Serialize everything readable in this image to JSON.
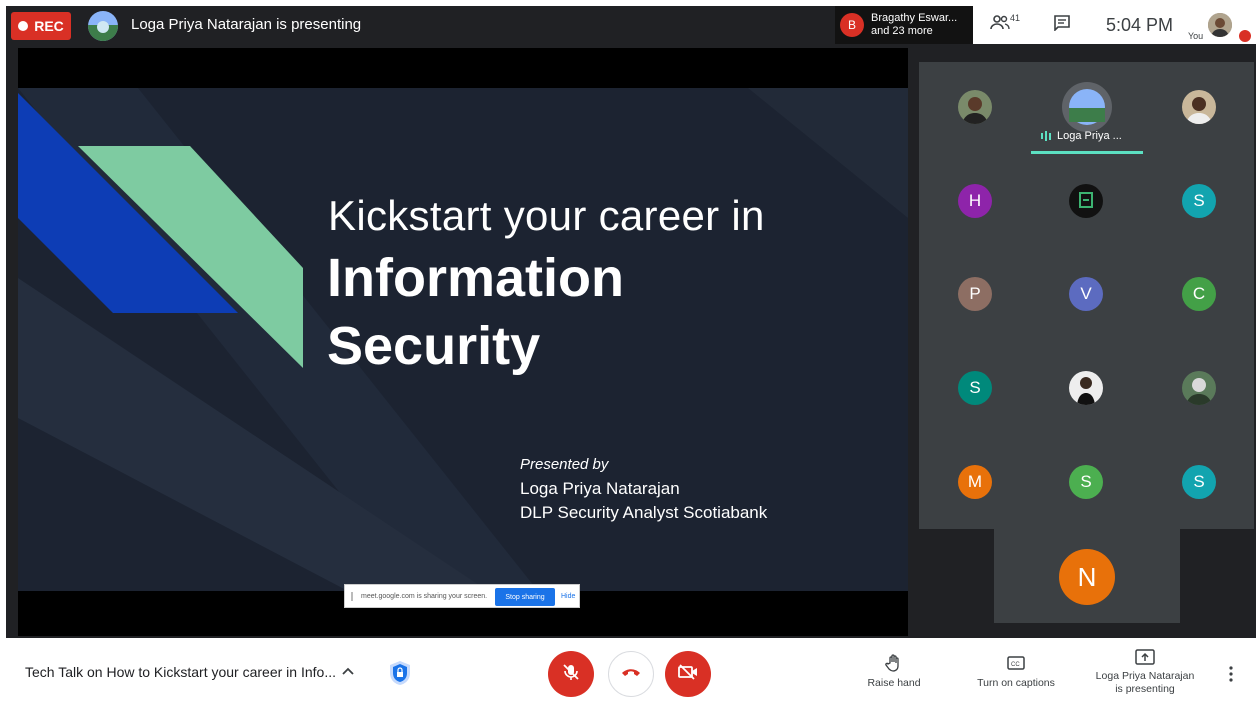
{
  "top_bar": {
    "rec_label": "REC",
    "presenting_title": "Loga Priya Natarajan is presenting",
    "raised_badge_letter": "B",
    "raised_line1": "Bragathy Eswar...",
    "raised_line2": "and 23 more",
    "people_count": "41",
    "time": "5:04 PM",
    "you_label": "You"
  },
  "slide": {
    "title_line1": "Kickstart your career in",
    "title_line2": "Information",
    "title_line3": "Security",
    "presented_by": "Presented by",
    "presenter": "Loga Priya Natarajan",
    "role": "DLP Security Analyst Scotiabank"
  },
  "share_notice": {
    "text": "meet.google.com is sharing your screen.",
    "stop_label": "Stop sharing",
    "hide_label": "Hide"
  },
  "participants": {
    "speaker_name": "Loga Priya ...",
    "tiles": [
      {
        "letter": "H",
        "color": "#8e24aa"
      },
      {
        "letter": "S",
        "color": "#12a4af"
      },
      {
        "letter": "P",
        "color": "#8d6e63"
      },
      {
        "letter": "V",
        "color": "#5c6bc0"
      },
      {
        "letter": "C",
        "color": "#43a047"
      },
      {
        "letter": "S",
        "color": "#00897b"
      },
      {
        "letter": "M",
        "color": "#e8710a"
      },
      {
        "letter": "S",
        "color": "#4caf50"
      },
      {
        "letter": "S",
        "color": "#12a4af"
      }
    ],
    "big_tile_letter": "N"
  },
  "bottom_bar": {
    "meeting_title": "Tech Talk on How to Kickstart your career in Info...",
    "raise_hand": "Raise hand",
    "captions": "Turn on captions",
    "presenting_line1": "Loga Priya Natarajan",
    "presenting_line2": "is presenting"
  }
}
